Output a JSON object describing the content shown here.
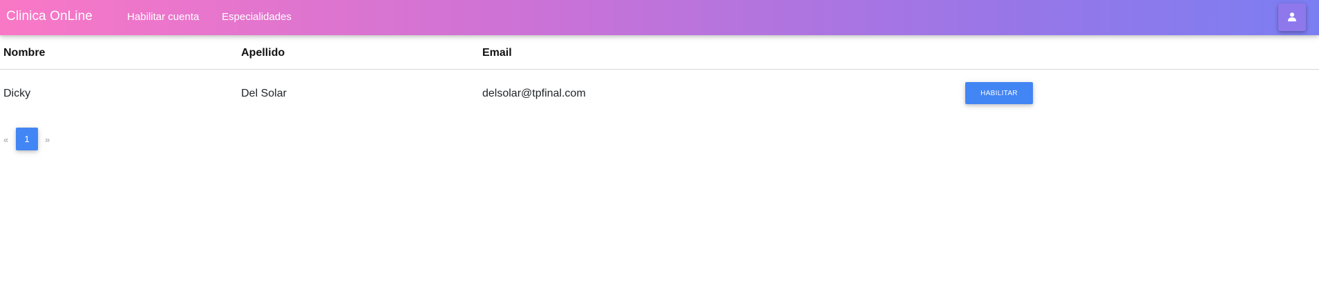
{
  "navbar": {
    "brand": "Clinica OnLine",
    "links": [
      {
        "label": "Habilitar cuenta"
      },
      {
        "label": "Especialidades"
      }
    ],
    "user_icon": "user-icon"
  },
  "table": {
    "headers": [
      "Nombre",
      "Apellido",
      "Email"
    ],
    "rows": [
      {
        "nombre": "Dicky",
        "apellido": "Del Solar",
        "email": "delsolar@tpfinal.com",
        "action_label": "HABILITAR"
      }
    ]
  },
  "pagination": {
    "prev": "«",
    "current": "1",
    "next": "»"
  },
  "colors": {
    "gradient_start": "#f978c6",
    "gradient_end": "#7b7ef2",
    "primary": "#4285f4"
  }
}
